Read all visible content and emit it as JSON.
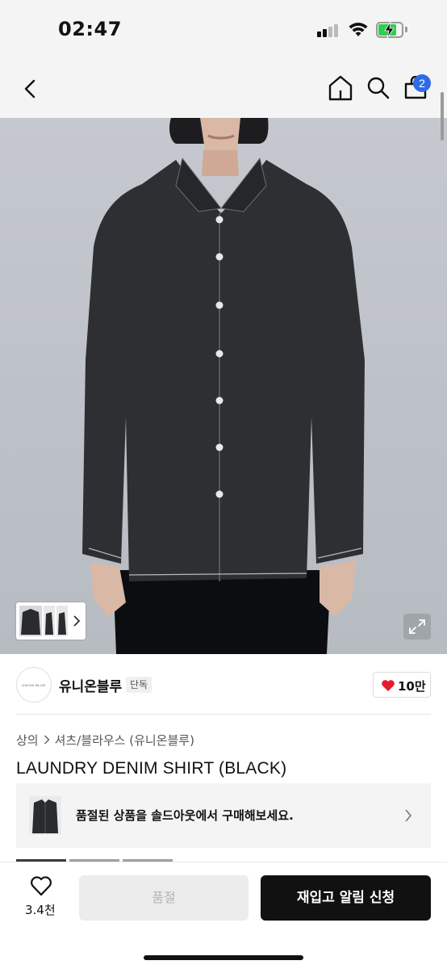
{
  "status_bar": {
    "time": "02:47",
    "icons": [
      "signal-icon",
      "wifi-icon",
      "battery-charging-icon"
    ],
    "battery_level": 0.8
  },
  "nav": {
    "icons": [
      "back-icon",
      "home-icon",
      "search-icon",
      "cart-icon"
    ],
    "cart_badge": "2"
  },
  "product": {
    "image_icons": [
      "thumbnail-strip",
      "chevron-right-icon",
      "expand-icon"
    ],
    "brand_name": "유니온블루",
    "brand_logo_text": "UNION BLUE",
    "exclusive_tag": "단독",
    "likes": "10만",
    "breadcrumb": [
      "상의",
      "셔츠/블라우스 (유니온블루)"
    ],
    "title": "LAUNDRY DENIM SHIRT (BLACK)"
  },
  "outlet_banner": {
    "text": "품절된 상품을 솔드아웃에서 구매해보세요."
  },
  "bottom_bar": {
    "wish_count": "3.4천",
    "soldout_label": "품절",
    "restock_label": "재입고 알림 신청"
  },
  "colors": {
    "accent_badge": "#2e6be6",
    "heart": "#e8192c",
    "battery": "#2fcf4e",
    "primary_button": "#111111"
  }
}
